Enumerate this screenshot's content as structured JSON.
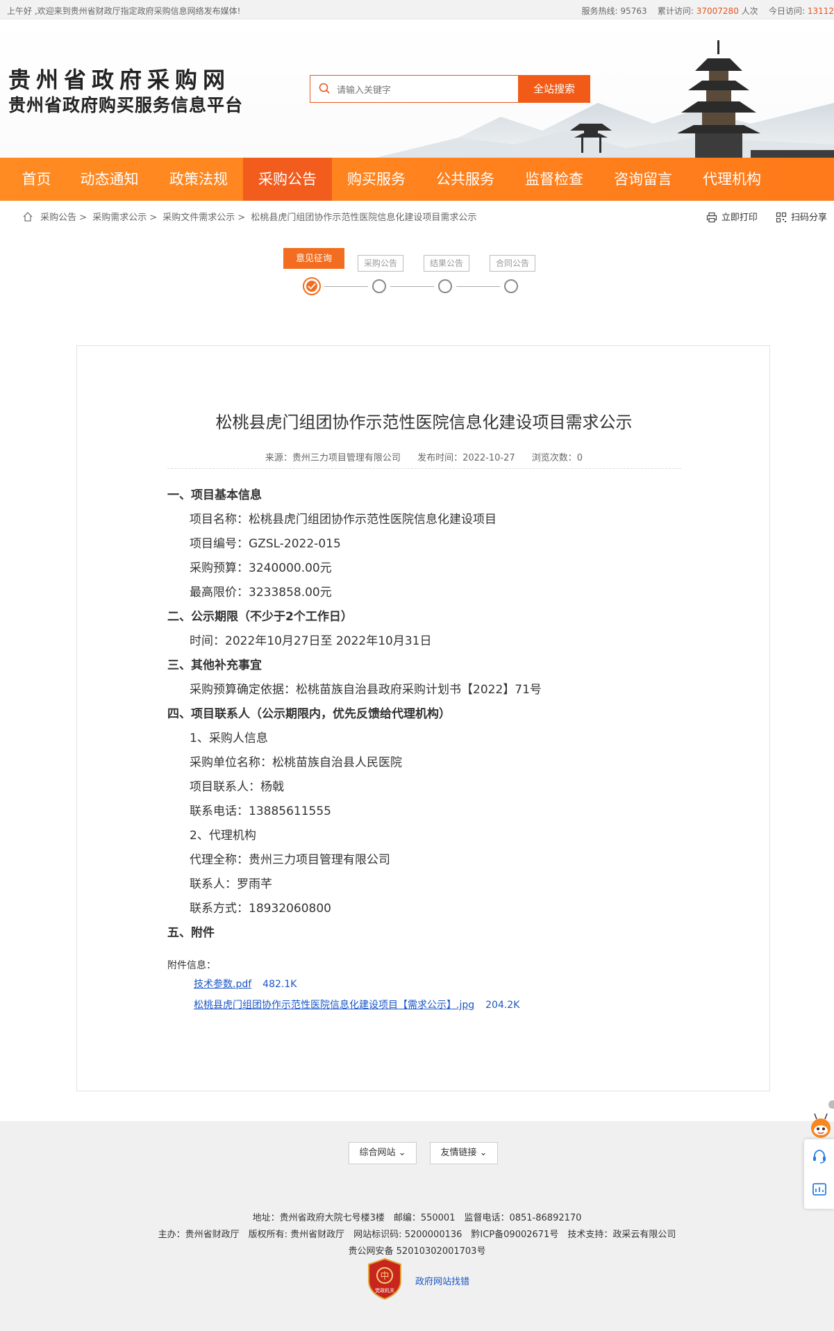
{
  "topbar": {
    "welcome": "上午好 ,欢迎来到贵州省财政厅指定政府采购信息网络发布媒体!",
    "hotline_label": "服务热线:",
    "hotline": "95763",
    "total_label": "累计访问:",
    "total": "37007280",
    "total_unit": "人次",
    "today_label": "今日访问:",
    "today": "13112"
  },
  "header": {
    "title": "贵州省政府采购网",
    "subtitle": "贵州省政府购买服务信息平台",
    "search_placeholder": "请输入关键字",
    "search_button": "全站搜索"
  },
  "nav": [
    "首页",
    "动态通知",
    "政策法规",
    "采购公告",
    "购买服务",
    "公共服务",
    "监督检查",
    "咨询留言",
    "代理机构"
  ],
  "breadcrumb": [
    "采购公告",
    "采购需求公示",
    "采购文件需求公示",
    "松桃县虎门组团协作示范性医院信息化建设项目需求公示"
  ],
  "tools": {
    "print": "立即打印",
    "share": "扫码分享"
  },
  "steps": [
    "意见征询",
    "采购公告",
    "结果公告",
    "合同公告"
  ],
  "article": {
    "title": "松桃县虎门组团协作示范性医院信息化建设项目需求公示",
    "source": "来源：贵州三力项目管理有限公司",
    "date": "发布时间：2022-10-27",
    "views": "浏览次数：0",
    "lines": [
      {
        "t": "h",
        "text": "一、项目基本信息"
      },
      {
        "t": "p",
        "text": "项目名称：松桃县虎门组团协作示范性医院信息化建设项目"
      },
      {
        "t": "p",
        "text": "项目编号：GZSL-2022-015"
      },
      {
        "t": "p",
        "text": "采购预算：3240000.00元"
      },
      {
        "t": "p",
        "text": "最高限价：3233858.00元"
      },
      {
        "t": "h",
        "text": "二、公示期限（不少于2个工作日）"
      },
      {
        "t": "p",
        "text": "时间：2022年10月27日至 2022年10月31日"
      },
      {
        "t": "h",
        "text": "三、其他补充事宜"
      },
      {
        "t": "p",
        "text": "采购预算确定依据：松桃苗族自治县政府采购计划书【2022】71号"
      },
      {
        "t": "h",
        "text": "四、项目联系人（公示期限内，优先反馈给代理机构）"
      },
      {
        "t": "p",
        "text": "1、采购人信息"
      },
      {
        "t": "p",
        "text": "采购单位名称：松桃苗族自治县人民医院"
      },
      {
        "t": "p",
        "text": "项目联系人：杨戟"
      },
      {
        "t": "p",
        "text": "联系电话：13885611555"
      },
      {
        "t": "p",
        "text": "2、代理机构"
      },
      {
        "t": "p",
        "text": "代理全称：贵州三力项目管理有限公司"
      },
      {
        "t": "p",
        "text": "联系人：罗雨芊"
      },
      {
        "t": "p",
        "text": "联系方式：18932060800"
      },
      {
        "t": "h",
        "text": "五、附件"
      }
    ],
    "attach_label": "附件信息：",
    "files": [
      {
        "name": "技术参数.pdf",
        "size": "482.1K"
      },
      {
        "name": "松桃县虎门组团协作示范性医院信息化建设项目【需求公示】.jpg",
        "size": "204.2K"
      }
    ]
  },
  "footer": {
    "select1": "综合网站",
    "select2": "友情链接",
    "line1": "地址：贵州省政府大院七号楼3楼　邮编：550001　监督电话：0851-86892170",
    "line2": "主办：贵州省财政厅　版权所有: 贵州省财政厅　网站标识码: 5200000136　黔ICP备09002671号　技术支持：政采云有限公司",
    "line3": "贵公网安备 52010302001703号",
    "badge_text": "党政机关",
    "fix_link": "政府网站找错"
  }
}
